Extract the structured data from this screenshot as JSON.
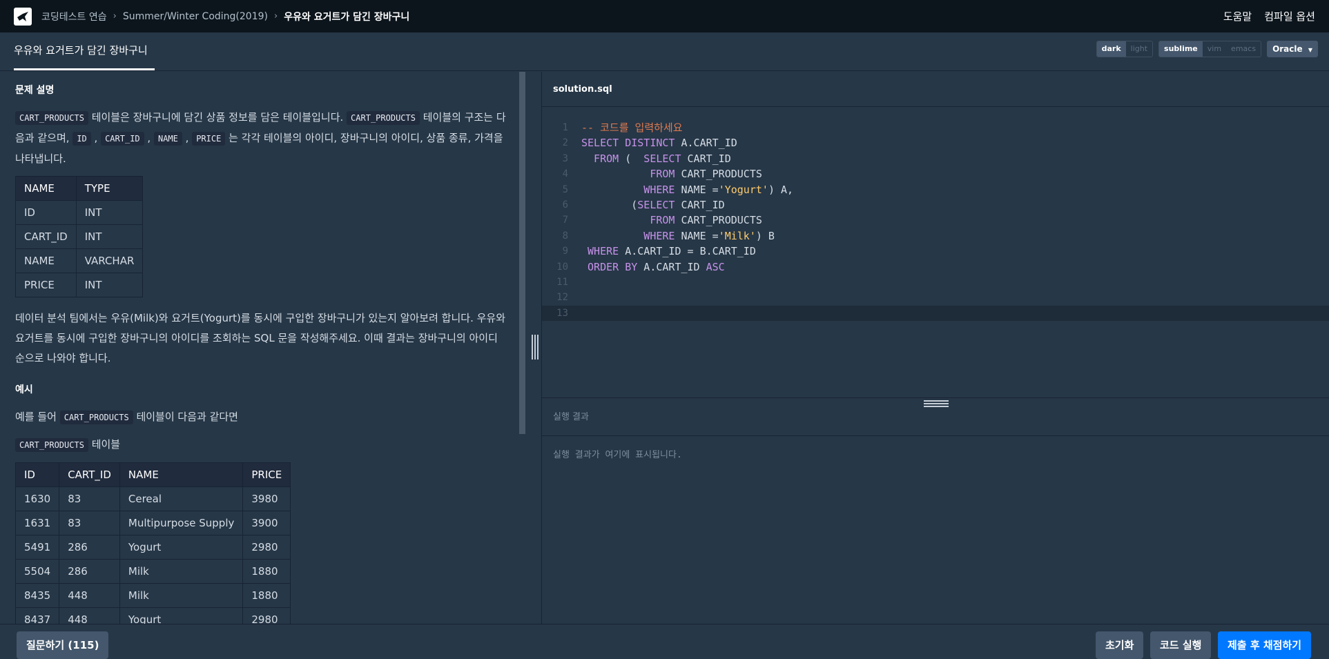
{
  "topbar": {
    "breadcrumb": [
      "코딩테스트 연습",
      "Summer/Winter Coding(2019)",
      "우유와 요거트가 담긴 장바구니"
    ],
    "help": "도움말",
    "compile_options": "컴파일 옵션"
  },
  "tab": {
    "title": "우유와 요거트가 담긴 장바구니"
  },
  "toggles": {
    "theme": [
      "dark",
      "light"
    ],
    "keymap": [
      "sublime",
      "vim",
      "emacs"
    ],
    "language": "Oracle"
  },
  "problem": {
    "heading": "문제 설명",
    "p1": {
      "t1": "CART_PRODUCTS",
      "t2": " 테이블은 장바구니에 담긴 상품 정보를 담은 테이블입니다. ",
      "t3": "CART_PRODUCTS",
      "t4": " 테이블의 구조는 다음과 같으며, ",
      "c1": "ID",
      "s1": " , ",
      "c2": "CART_ID",
      "s2": " , ",
      "c3": "NAME",
      "s3": " , ",
      "c4": "PRICE",
      "t5": " 는 각각 테이블의 아이디, 장바구니의 아이디, 상품 종류, 가격을 나타냅니다."
    },
    "schema": {
      "headers": [
        "NAME",
        "TYPE"
      ],
      "rows": [
        [
          "ID",
          "INT"
        ],
        [
          "CART_ID",
          "INT"
        ],
        [
          "NAME",
          "VARCHAR"
        ],
        [
          "PRICE",
          "INT"
        ]
      ]
    },
    "p2": "데이터 분석 팀에서는 우유(Milk)와 요거트(Yogurt)를 동시에 구입한 장바구니가 있는지 알아보려 합니다. 우유와 요거트를 동시에 구입한 장바구니의 아이디를 조회하는 SQL 문을 작성해주세요. 이때 결과는 장바구니의 아이디 순으로 나와야 합니다.",
    "example_heading": "예시",
    "example_intro": {
      "t1": "예를 들어 ",
      "c1": "CART_PRODUCTS",
      "t2": " 테이블이 다음과 같다면"
    },
    "table_label": {
      "c1": "CART_PRODUCTS",
      "t1": " 테이블"
    },
    "example_table": {
      "headers": [
        "ID",
        "CART_ID",
        "NAME",
        "PRICE"
      ],
      "rows": [
        [
          "1630",
          "83",
          "Cereal",
          "3980"
        ],
        [
          "1631",
          "83",
          "Multipurpose Supply",
          "3900"
        ],
        [
          "5491",
          "286",
          "Yogurt",
          "2980"
        ],
        [
          "5504",
          "286",
          "Milk",
          "1880"
        ],
        [
          "8435",
          "448",
          "Milk",
          "1880"
        ],
        [
          "8437",
          "448",
          "Yogurt",
          "2980"
        ]
      ]
    }
  },
  "editor": {
    "filename": "solution.sql",
    "line_numbers": [
      "1",
      "2",
      "3",
      "4",
      "5",
      "6",
      "7",
      "8",
      "9",
      "10",
      "11",
      "12",
      "13"
    ],
    "active_line": 13,
    "tokens": {
      "l1": "-- 코드를 입력하세요",
      "l2a": "SELECT DISTINCT",
      "l2b": " A.CART_ID",
      "l3a": "  FROM",
      "l3b": " ( ",
      "l3c": " SELECT",
      "l3d": " CART_ID",
      "l4a": "           FROM",
      "l4b": " CART_PRODUCTS",
      "l5a": "          WHERE",
      "l5b": " NAME =",
      "l5c": "'Yogurt'",
      "l5d": ") A,",
      "l6a": "        (",
      "l6b": "SELECT",
      "l6c": " CART_ID",
      "l7a": "           FROM",
      "l7b": " CART_PRODUCTS",
      "l8a": "          WHERE",
      "l8b": " NAME =",
      "l8c": "'Milk'",
      "l8d": ") B",
      "l9a": " WHERE",
      "l9b": " A.CART_ID = B.CART_ID",
      "l10a": " ORDER BY",
      "l10b": " A.CART_ID ",
      "l10c": "ASC"
    }
  },
  "result": {
    "heading": "실행 결과",
    "placeholder": "실행 결과가 여기에 표시됩니다."
  },
  "bottom": {
    "ask": "질문하기 (115)",
    "reset": "초기화",
    "run": "코드 실행",
    "submit": "제출 후 채점하기"
  },
  "colors": {
    "background": "#263747",
    "topbar": "#0c151c",
    "keyword": "#c792ea",
    "string": "#ffcb6b",
    "comment": "#e27b4f",
    "primary_button": "#0078ff"
  }
}
